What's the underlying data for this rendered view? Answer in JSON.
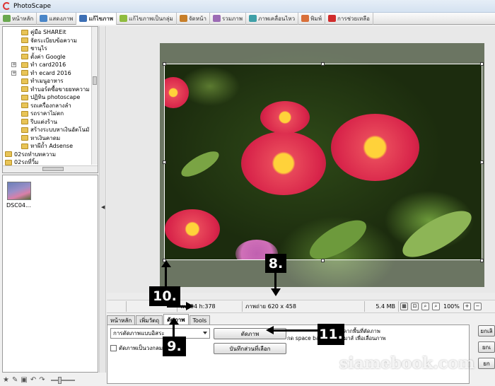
{
  "app": {
    "title": "PhotoScape"
  },
  "tabs": [
    {
      "label": "หน้าหลัก",
      "icon": "home-icon",
      "color": "#6aa84f"
    },
    {
      "label": "แสดงภาพ",
      "icon": "viewer-icon",
      "color": "#4a86c8"
    },
    {
      "label": "แก้ไขภาพ",
      "icon": "editor-icon",
      "color": "#3d6fb5",
      "active": true
    },
    {
      "label": "แก้ไขภาพเป็นกลุ่ม",
      "icon": "batch-icon",
      "color": "#8fbc3f"
    },
    {
      "label": "จัดหน้า",
      "icon": "page-icon",
      "color": "#c77f2a"
    },
    {
      "label": "รวมภาพ",
      "icon": "combine-icon",
      "color": "#9c6bb5"
    },
    {
      "label": "ภาพเคลื่อนไหว",
      "icon": "gif-icon",
      "color": "#3fa0a8"
    },
    {
      "label": "พิมพ์",
      "icon": "print-icon",
      "color": "#d9703a"
    },
    {
      "label": "การช่วยเหลือ",
      "icon": "help-icon",
      "color": "#d02b2b"
    }
  ],
  "tree": {
    "items": [
      "คู่มือ SHAREit",
      "จัดระเบียบข้อความ",
      "ชานุไร",
      "ตั้งค่า Google",
      "ทำ card2016",
      "ทำ ecard 2016",
      "ทำเมนูอาหาร",
      "ทำบอร์ดซื้อขายยทความ",
      "ปฏิทิน photoscape",
      "รถเครื่องกลางลำ",
      "รถราคาไม่ตก",
      "รีบแต่งร้าน",
      "สร้างระบบหาเงินอัตโนมั",
      "หาเงินคาดม",
      "หาผีถ้ำ Adsense"
    ],
    "root_items": [
      "02รถทำบทความ",
      "02รถที่วิ้ม"
    ]
  },
  "thumbnails": [
    {
      "label": "DSC04..."
    }
  ],
  "status": {
    "size_label": "w:604 h:378",
    "photo_info": "ภาพถ่าย 620 x 458",
    "file_size": "5.4 MB",
    "zoom": "100%"
  },
  "editor_tabs": [
    "หน้าหลัก",
    "เพิ่มวัตถุ",
    "ตัดภาพ",
    "Tools"
  ],
  "editor_active_tab": 2,
  "crop_panel": {
    "mode_select": "การตัดภาพแบบอิสระ",
    "checkbox_label": "ตัดภาพเป็นวงกลมหรือวงรี",
    "crop_button": "ตัดภาพ",
    "save_part_button": "บันทึกส่วนที่เลือก",
    "hint_line1": "คลิกและลากพื้นที่ตัดภาพ",
    "hint_line2": "กด space bar และลากเมาส์ เพื่อเลื่อนภาพ"
  },
  "right_buttons": [
    "ยกเลิ",
    "ยกเ",
    "ยก"
  ],
  "callouts": [
    "8.",
    "9.",
    "10.",
    "11."
  ],
  "watermark": "siamebook.com"
}
